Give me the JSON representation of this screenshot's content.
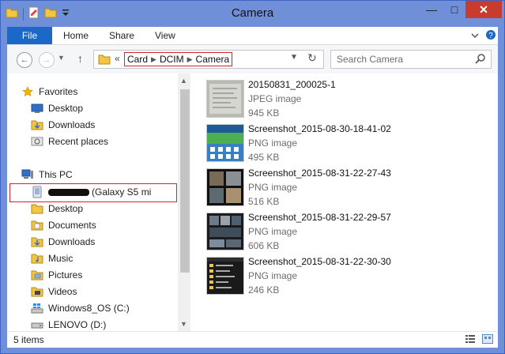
{
  "window": {
    "title": "Camera"
  },
  "ribbon": {
    "file_tab": "File",
    "tabs": [
      "Home",
      "Share",
      "View"
    ]
  },
  "address": {
    "crumbs": [
      "Card",
      "DCIM",
      "Camera"
    ],
    "prefix": "«"
  },
  "search": {
    "placeholder": "Search Camera"
  },
  "nav": {
    "favorites_label": "Favorites",
    "favorites": [
      "Desktop",
      "Downloads",
      "Recent places"
    ],
    "thispc_label": "This PC",
    "device_label": "(Galaxy S5 mi",
    "pc_items": [
      "Desktop",
      "Documents",
      "Downloads",
      "Music",
      "Pictures",
      "Videos",
      "Windows8_OS (C:)",
      "LENOVO (D:)"
    ]
  },
  "files": [
    {
      "name": "20150831_200025-1",
      "type": "JPEG image",
      "size": "945 KB"
    },
    {
      "name": "Screenshot_2015-08-30-18-41-02",
      "type": "PNG image",
      "size": "495 KB"
    },
    {
      "name": "Screenshot_2015-08-31-22-27-43",
      "type": "PNG image",
      "size": "516 KB"
    },
    {
      "name": "Screenshot_2015-08-31-22-29-57",
      "type": "PNG image",
      "size": "606 KB"
    },
    {
      "name": "Screenshot_2015-08-31-22-30-30",
      "type": "PNG image",
      "size": "246 KB"
    }
  ],
  "status": {
    "count": "5 items"
  },
  "colors": {
    "title_bar": "#6f8fd8",
    "file_tab": "#1a68c8",
    "close": "#c83c2f",
    "highlight": "#d6222b"
  }
}
